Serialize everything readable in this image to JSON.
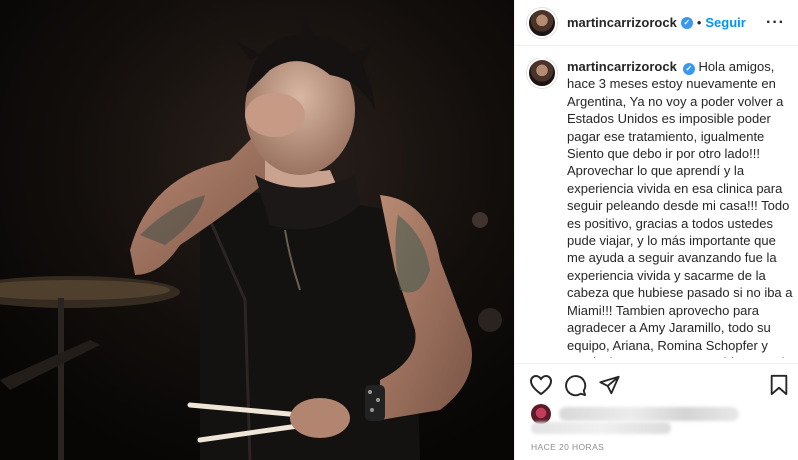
{
  "header": {
    "username": "martincarrizorock",
    "separator": "•",
    "follow_label": "Seguir",
    "more_label": "···"
  },
  "caption": {
    "username": "martincarrizorock",
    "text": " Hola amigos, hace 3 meses estoy nuevamente en Argentina, Ya no voy a poder volver a Estados Unidos es imposible poder pagar ese tratamiento, igualmente Siento que debo ir por otro lado!!! Aprovechar lo que aprendí y la experiencia vivida en esa clinica para seguir peleando desde mi casa!!! Todo es positivo, gracias a todos ustedes pude viajar, y lo más importante que me ayuda a seguir avanzando fue la experiencia vivida y sacarme de la cabeza que hubiese pasado si no iba a Miami!!! Tambien aprovecho para agradecer a Amy Jaramillo, todo su equipo, Ariana, Romina Schopfer y Martincito, que tanto me cuidaron cada minuto e hicieron que sienta que"
  },
  "actions": {
    "like_icon": "heart-icon",
    "comment_icon": "comment-icon",
    "share_icon": "share-icon",
    "save_icon": "bookmark-icon"
  },
  "timestamp": "HACE 20 HORAS",
  "colors": {
    "accent": "#0095f6",
    "verified": "#3897f0",
    "muted": "#8e8e8e",
    "text": "#262626"
  }
}
